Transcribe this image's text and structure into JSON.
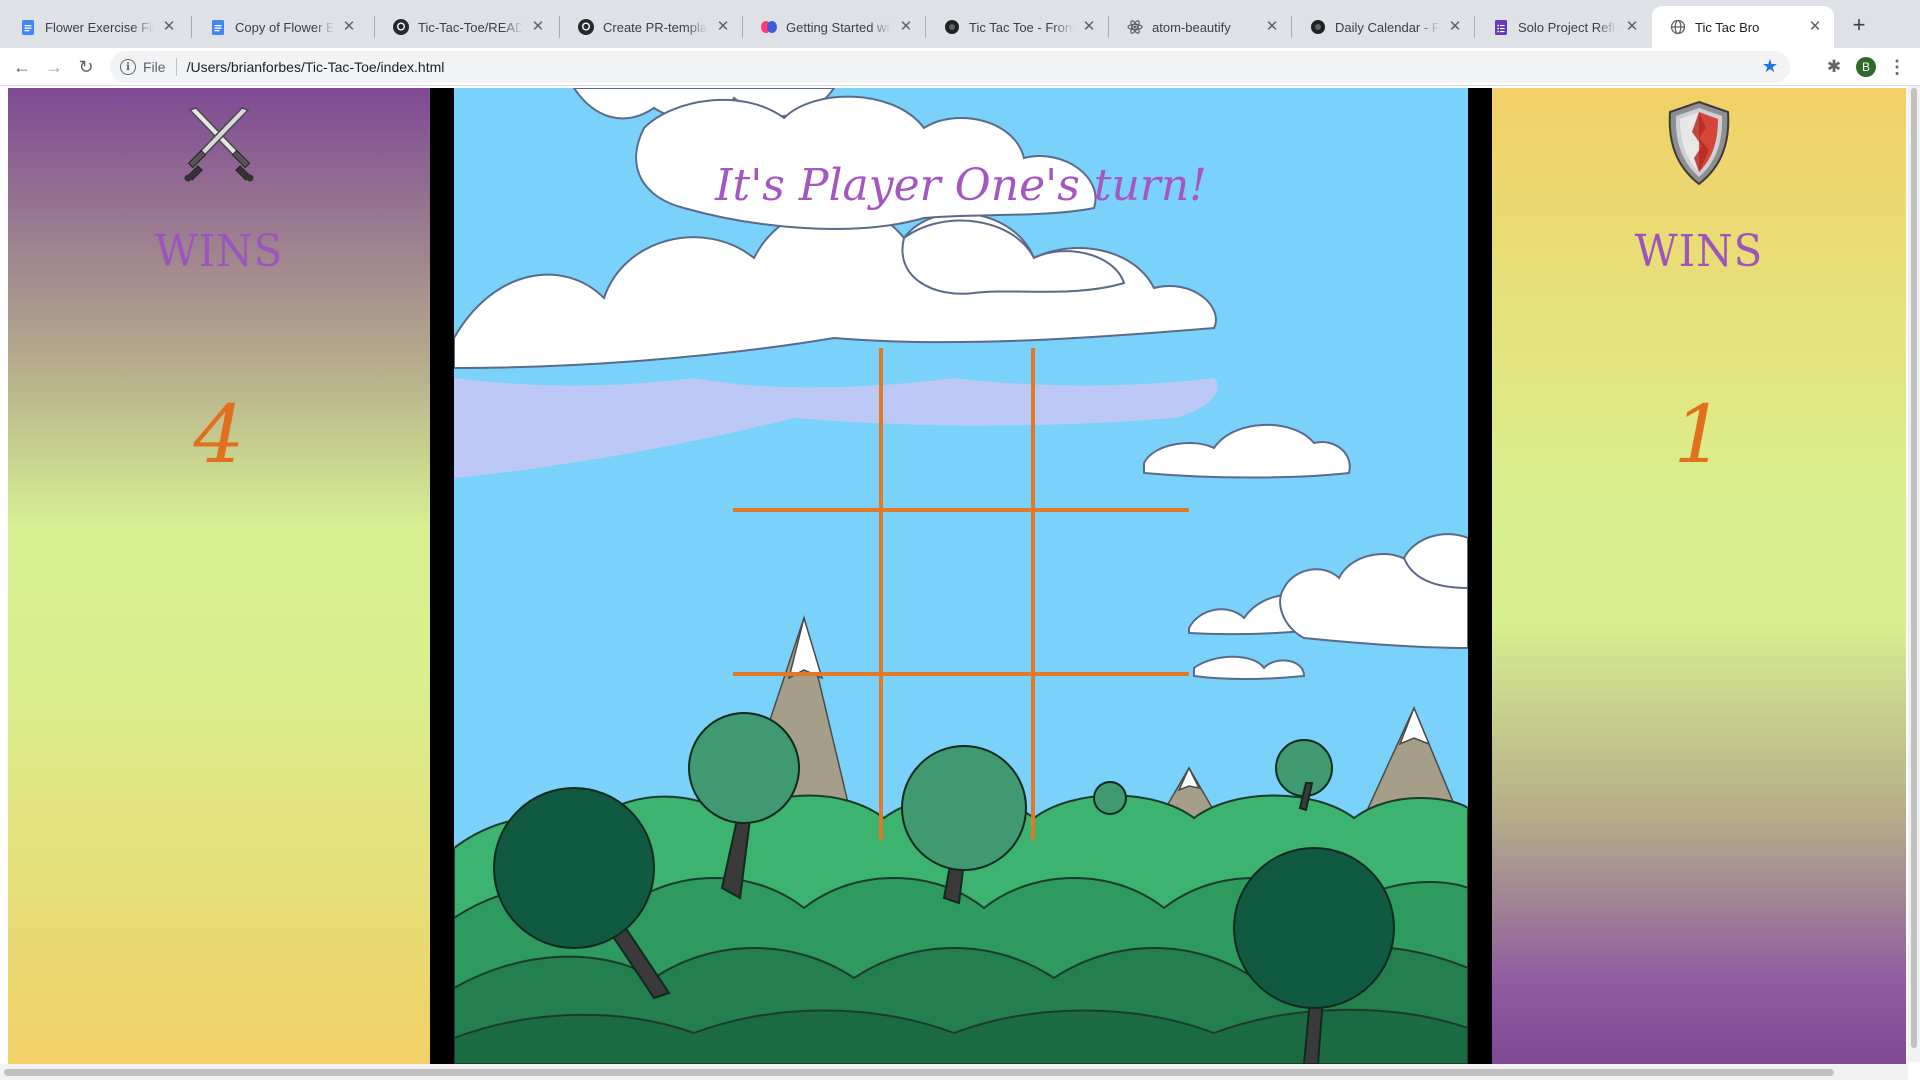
{
  "browser": {
    "tabs": [
      {
        "title": "Flower Exercise Final",
        "icon": "google-docs-icon",
        "active": false
      },
      {
        "title": "Copy of Flower Exercise",
        "icon": "google-docs-icon",
        "active": false
      },
      {
        "title": "Tic-Tac-Toe/README.md",
        "icon": "github-icon",
        "active": false
      },
      {
        "title": "Create PR-template.md",
        "icon": "github-icon",
        "active": false
      },
      {
        "title": "Getting Started with",
        "icon": "app-logo-icon",
        "active": false
      },
      {
        "title": "Tic Tac Toe - Front-End",
        "icon": "site-icon",
        "active": false
      },
      {
        "title": "atom-beautify",
        "icon": "atom-icon",
        "active": false
      },
      {
        "title": "Daily Calendar - Front",
        "icon": "site-icon",
        "active": false
      },
      {
        "title": "Solo Project Reflection",
        "icon": "google-forms-icon",
        "active": false
      },
      {
        "title": "Tic Tac Bro",
        "icon": "globe-icon",
        "active": true
      }
    ],
    "address": {
      "scheme": "File",
      "url": "/Users/brianforbes/Tic-Tac-Toe/index.html"
    },
    "profile_initial": "B"
  },
  "game": {
    "turn_message": "It's Player One's turn!",
    "player_one": {
      "token": "crossed-swords-icon",
      "wins_label": "WINS",
      "wins": "4"
    },
    "player_two": {
      "token": "shield-icon",
      "wins_label": "WINS",
      "wins": "1"
    },
    "board": [
      "",
      "",
      "",
      "",
      "",
      "",
      "",
      "",
      ""
    ]
  },
  "colors": {
    "accent_purple": "#9a56bb",
    "accent_orange": "#e1701e",
    "grid_orange": "#e07a28",
    "sky": "#7ad2fa"
  }
}
